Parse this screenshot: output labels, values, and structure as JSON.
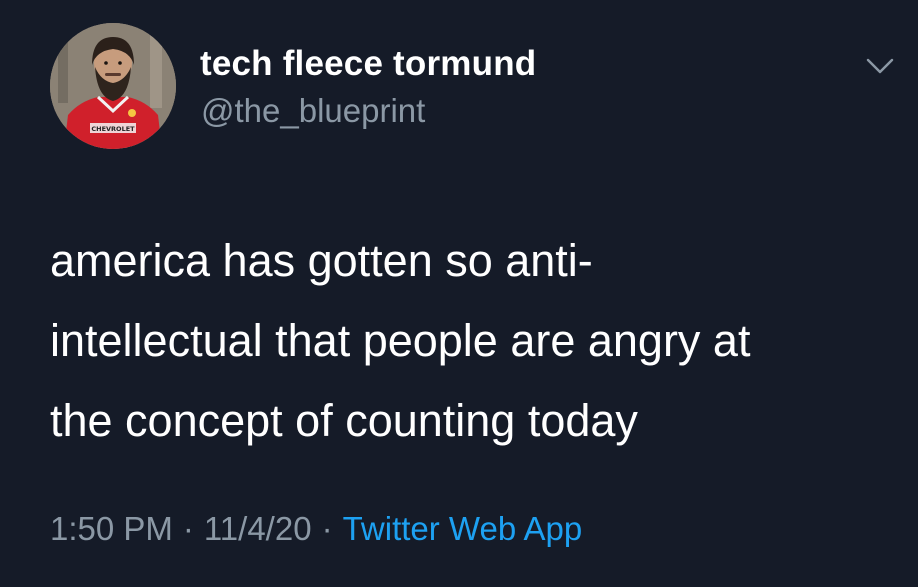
{
  "user": {
    "display_name": "tech fleece tormund",
    "handle": "@the_blueprint",
    "avatar": {
      "icon": "profile-photo-avatar",
      "jersey_text": "CHEVROLET"
    }
  },
  "tweet": {
    "text_lines": [
      "america has gotten so anti-",
      "intellectual that people are angry at",
      "the concept of counting today"
    ]
  },
  "meta": {
    "time": "1:50 PM",
    "separator": "·",
    "date": "11/4/20",
    "source": "Twitter Web App"
  },
  "colors": {
    "background": "#151b28",
    "primary_text": "#ffffff",
    "secondary_text": "#8b98a5",
    "link": "#1da1f2"
  },
  "icons": {
    "menu": "chevron-down-icon"
  }
}
